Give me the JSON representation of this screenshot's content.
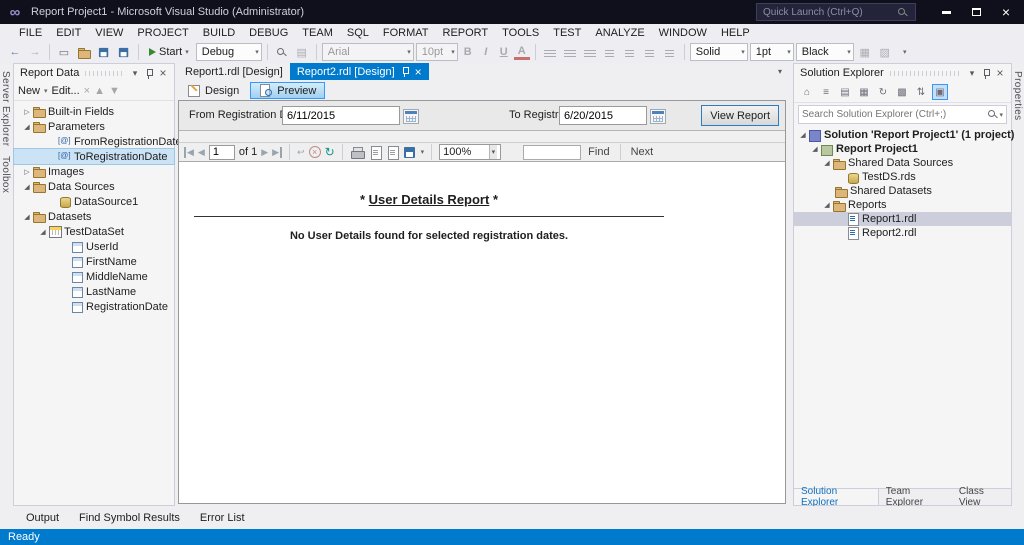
{
  "colors": {
    "accent": "#007ACC",
    "titlebar_bg": "#10101C",
    "statusbar_bg": "#007ACC",
    "active_tab_bg": "#007ACC"
  },
  "titlebar": {
    "title": "Report Project1 - Microsoft Visual Studio (Administrator)",
    "quick_launch_placeholder": "Quick Launch (Ctrl+Q)"
  },
  "menubar": {
    "items": [
      "FILE",
      "EDIT",
      "VIEW",
      "PROJECT",
      "BUILD",
      "DEBUG",
      "TEAM",
      "SQL",
      "FORMAT",
      "REPORT",
      "TOOLS",
      "TEST",
      "ANALYZE",
      "WINDOW",
      "HELP"
    ]
  },
  "toolbar": {
    "start_label": "Start",
    "debug_label": "Debug",
    "font_name": "Arial",
    "font_size": "10pt",
    "border_style": "Solid",
    "border_width": "1pt",
    "border_color": "Black"
  },
  "left_strip": {
    "items": [
      "Server Explorer",
      "Toolbox"
    ]
  },
  "right_strip": {
    "items": [
      "Properties"
    ]
  },
  "report_data_panel": {
    "title": "Report Data",
    "new_label": "New",
    "edit_label": "Edit...",
    "tree": [
      {
        "label": "Built-in Fields",
        "icon": "folder",
        "level": 0,
        "expanded": false
      },
      {
        "label": "Parameters",
        "icon": "folder",
        "level": 0,
        "expanded": true
      },
      {
        "label": "FromRegistrationDate",
        "icon": "parameter",
        "level": 1
      },
      {
        "label": "ToRegistrationDate",
        "icon": "parameter",
        "level": 1,
        "selected": true
      },
      {
        "label": "Images",
        "icon": "folder",
        "level": 0,
        "expanded": false
      },
      {
        "label": "Data Sources",
        "icon": "folder",
        "level": 0,
        "expanded": true
      },
      {
        "label": "DataSource1",
        "icon": "database",
        "level": 1
      },
      {
        "label": "Datasets",
        "icon": "folder",
        "level": 0,
        "expanded": true
      },
      {
        "label": "TestDataSet",
        "icon": "dataset-table",
        "level": 1,
        "expanded": true
      },
      {
        "label": "UserId",
        "icon": "field",
        "level": 2
      },
      {
        "label": "FirstName",
        "icon": "field",
        "level": 2
      },
      {
        "label": "MiddleName",
        "icon": "field",
        "level": 2
      },
      {
        "label": "LastName",
        "icon": "field",
        "level": 2
      },
      {
        "label": "RegistrationDate",
        "icon": "field",
        "level": 2
      }
    ]
  },
  "editor": {
    "tabs": [
      {
        "label": "Report1.rdl [Design]",
        "active": false
      },
      {
        "label": "Report2.rdl [Design]",
        "active": true
      }
    ],
    "design_tab": "Design",
    "preview_tab": "Preview"
  },
  "preview": {
    "from_label": "From Registration Date",
    "from_value": "6/11/2015",
    "to_label": "To Registration Date",
    "to_value": "6/20/2015",
    "view_report_label": "View Report",
    "page_value": "1",
    "of_label": "of 1",
    "zoom_value": "100%",
    "find_label": "Find",
    "next_label": "Next",
    "report_star": "*",
    "report_title": "User Details Report",
    "report_message": "No User Details found for selected registration dates."
  },
  "solution_explorer": {
    "title": "Solution Explorer",
    "search_placeholder": "Search Solution Explorer (Ctrl+;)",
    "tree": [
      {
        "label": "Solution 'Report Project1' (1 project)",
        "icon": "solution",
        "level": 0,
        "expanded": true
      },
      {
        "label": "Report Project1",
        "icon": "project",
        "level": 1,
        "expanded": true
      },
      {
        "label": "Shared Data Sources",
        "icon": "folder",
        "level": 2,
        "expanded": true
      },
      {
        "label": "TestDS.rds",
        "icon": "datasource",
        "level": 3
      },
      {
        "label": "Shared Datasets",
        "icon": "folder",
        "level": 2
      },
      {
        "label": "Reports",
        "icon": "folder",
        "level": 2,
        "expanded": true
      },
      {
        "label": "Report1.rdl",
        "icon": "report",
        "level": 3,
        "selected": true
      },
      {
        "label": "Report2.rdl",
        "icon": "report",
        "level": 3
      }
    ],
    "bottom_tabs": [
      "Solution Explorer",
      "Team Explorer",
      "Class View"
    ]
  },
  "bottom_panel": {
    "tabs": [
      "Output",
      "Find Symbol Results",
      "Error List"
    ]
  },
  "statusbar": {
    "text": "Ready"
  }
}
